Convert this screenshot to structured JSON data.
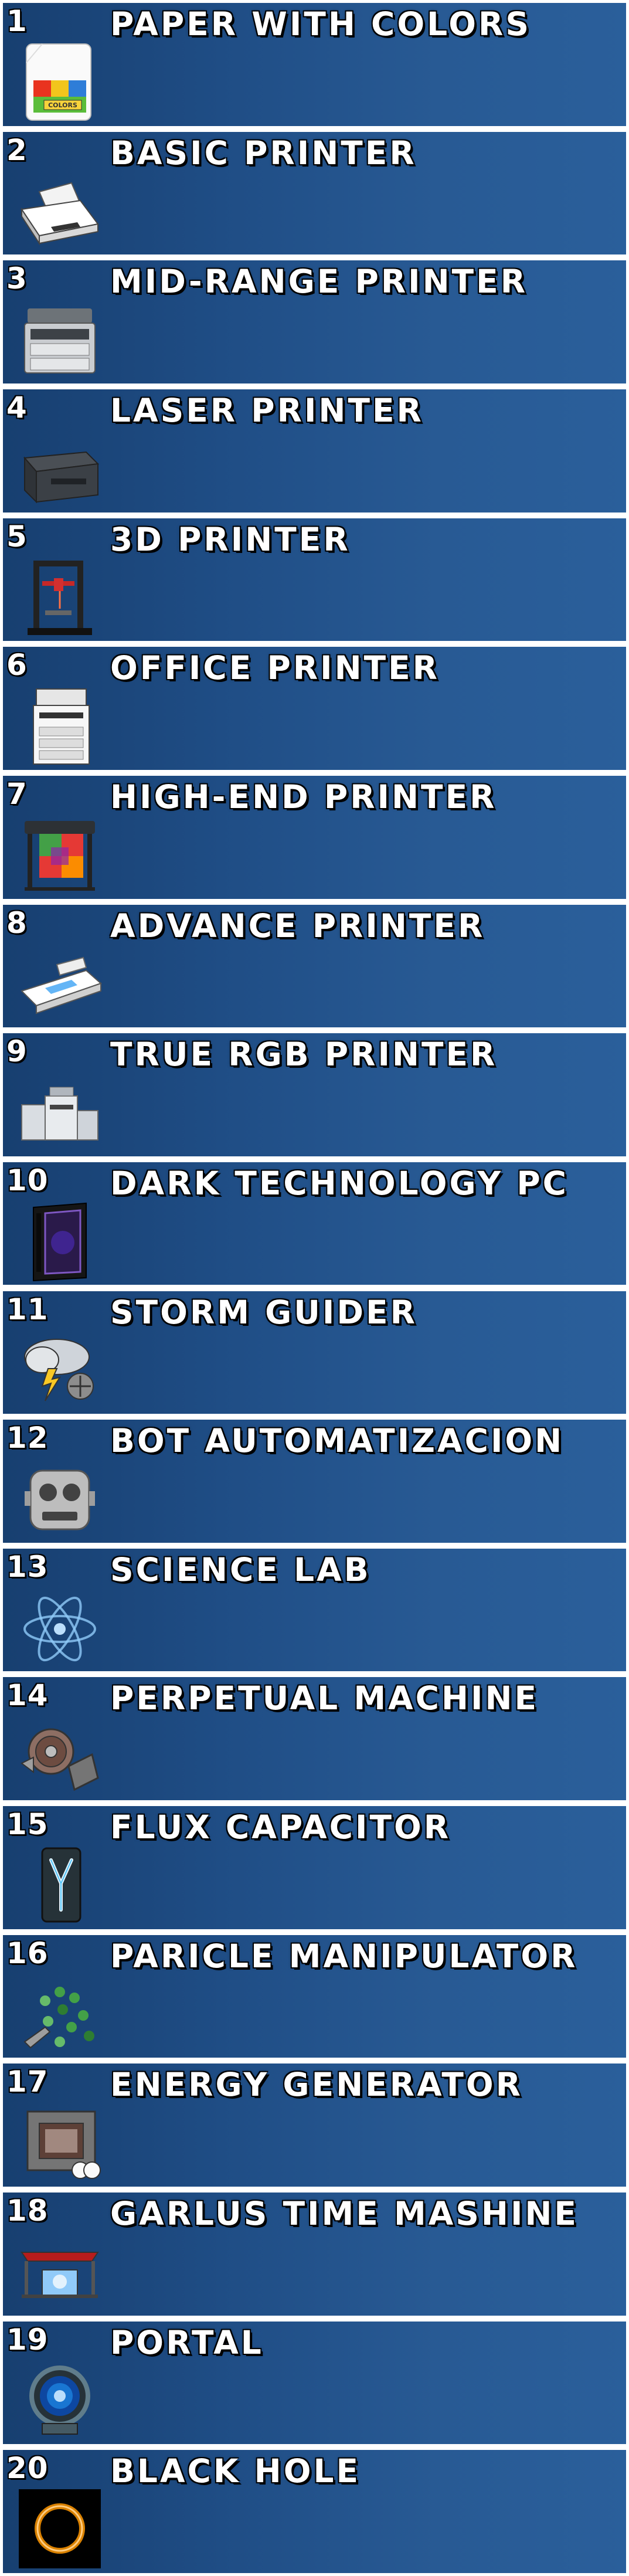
{
  "items": [
    {
      "number": "1",
      "name": "PAPER WITH COLORS",
      "icon": "paper-with-colors-icon",
      "icon_text": "COLORS"
    },
    {
      "number": "2",
      "name": "BASIC PRINTER",
      "icon": "basic-printer-icon"
    },
    {
      "number": "3",
      "name": "MID-RANGE PRINTER",
      "icon": "mid-range-printer-icon"
    },
    {
      "number": "4",
      "name": "LASER PRINTER",
      "icon": "laser-printer-icon"
    },
    {
      "number": "5",
      "name": "3D PRINTER",
      "icon": "3d-printer-icon"
    },
    {
      "number": "6",
      "name": "OFFICE PRINTER",
      "icon": "office-printer-icon"
    },
    {
      "number": "7",
      "name": "HIGH-END PRINTER",
      "icon": "high-end-printer-icon"
    },
    {
      "number": "8",
      "name": "ADVANCE PRINTER",
      "icon": "advance-printer-icon"
    },
    {
      "number": "9",
      "name": "TRUE RGB PRINTER",
      "icon": "true-rgb-printer-icon"
    },
    {
      "number": "10",
      "name": "DARK TECHNOLOGY PC",
      "icon": "dark-technology-pc-icon"
    },
    {
      "number": "11",
      "name": "STORM GUIDER",
      "icon": "storm-guider-icon"
    },
    {
      "number": "12",
      "name": "BOT AUTOMATIZACION",
      "icon": "bot-icon"
    },
    {
      "number": "13",
      "name": "SCIENCE LAB",
      "icon": "atom-icon"
    },
    {
      "number": "14",
      "name": "PERPETUAL MACHINE",
      "icon": "perpetual-machine-icon"
    },
    {
      "number": "15",
      "name": "FLUX CAPACITOR",
      "icon": "flux-capacitor-icon"
    },
    {
      "number": "16",
      "name": "PARICLE MANIPULATOR",
      "icon": "particle-manipulator-icon"
    },
    {
      "number": "17",
      "name": "ENERGY GENERATOR",
      "icon": "energy-generator-icon"
    },
    {
      "number": "18",
      "name": "GARLUS TIME MASHINE",
      "icon": "time-machine-icon"
    },
    {
      "number": "19",
      "name": "PORTAL",
      "icon": "portal-icon"
    },
    {
      "number": "20",
      "name": "BLACK HOLE",
      "icon": "black-hole-icon"
    }
  ]
}
